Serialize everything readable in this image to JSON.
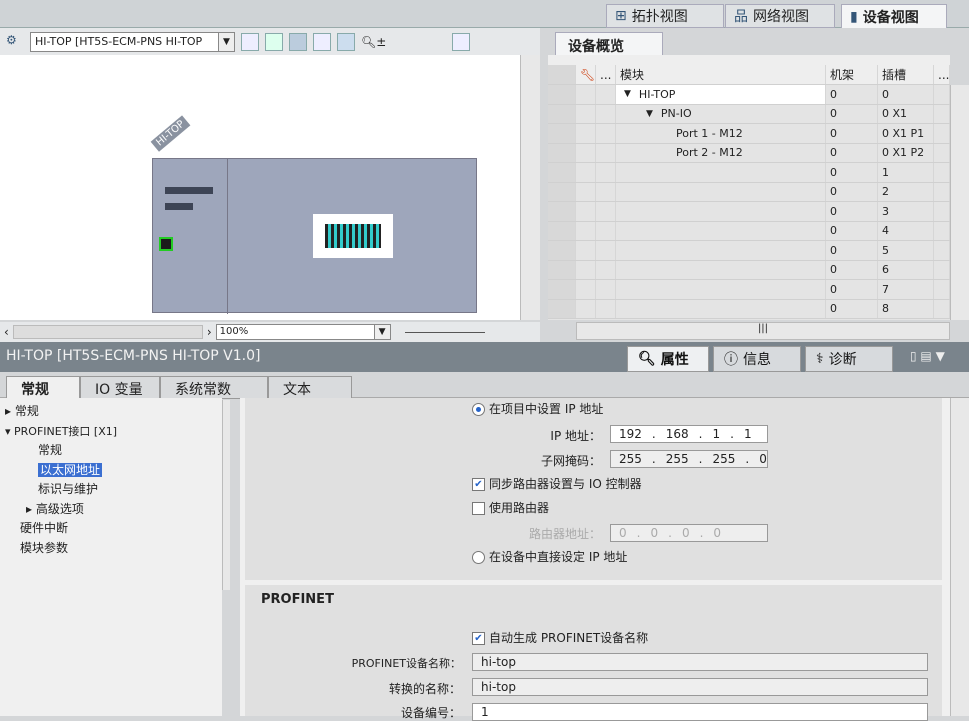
{
  "view_tabs": [
    {
      "label": "拓扑视图",
      "icon": "topology-icon"
    },
    {
      "label": "网络视图",
      "icon": "network-icon"
    },
    {
      "label": "设备视图",
      "icon": "device-icon",
      "active": true
    }
  ],
  "toolbar": {
    "device_select": "HI-TOP [HT5S-ECM-PNS HI-TOP"
  },
  "canvas": {
    "device_label": "HI-TOP",
    "zoom": "100%"
  },
  "overview": {
    "tab": "设备概览",
    "headers": [
      "...",
      "模块",
      "机架",
      "插槽",
      "..."
    ],
    "rows": [
      {
        "module": "HI-TOP",
        "rack": "0",
        "slot": "0",
        "level": 0,
        "expand": "▼"
      },
      {
        "module": "PN-IO",
        "rack": "0",
        "slot": "0 X1",
        "level": 1,
        "expand": "▼"
      },
      {
        "module": "Port 1 - M12",
        "rack": "0",
        "slot": "0 X1 P1",
        "level": 2,
        "expand": ""
      },
      {
        "module": "Port 2 - M12",
        "rack": "0",
        "slot": "0 X1 P2",
        "level": 2,
        "expand": ""
      },
      {
        "module": "",
        "rack": "0",
        "slot": "1"
      },
      {
        "module": "",
        "rack": "0",
        "slot": "2"
      },
      {
        "module": "",
        "rack": "0",
        "slot": "3"
      },
      {
        "module": "",
        "rack": "0",
        "slot": "4"
      },
      {
        "module": "",
        "rack": "0",
        "slot": "5"
      },
      {
        "module": "",
        "rack": "0",
        "slot": "6"
      },
      {
        "module": "",
        "rack": "0",
        "slot": "7"
      },
      {
        "module": "",
        "rack": "0",
        "slot": "8"
      }
    ],
    "hscroll": "|||"
  },
  "inspector": {
    "title": "HI-TOP [HT5S-ECM-PNS HI-TOP V1.0]",
    "tabs": [
      "属性",
      "信息",
      "诊断"
    ],
    "subtabs": [
      "常规",
      "IO 变量",
      "系统常数",
      "文本"
    ],
    "tree": [
      "常规",
      "PROFINET接口 [X1]",
      "常规",
      "以太网地址",
      "标识与维护",
      "高级选项",
      "硬件中断",
      "模块参数"
    ],
    "ip": {
      "set_in_project": "在项目中设置 IP 地址",
      "ip_label": "IP 地址：",
      "ip": [
        "192",
        "168",
        "1",
        "1"
      ],
      "mask_label": "子网掩码：",
      "mask": [
        "255",
        "255",
        "255",
        "0"
      ],
      "sync_router": "同步路由器设置与 IO 控制器",
      "use_router": "使用路由器",
      "router_label": "路由器地址：",
      "router": [
        "0",
        "0",
        "0",
        "0"
      ],
      "set_on_device": "在设备中直接设定 IP 地址"
    },
    "profinet": {
      "heading": "PROFINET",
      "auto_name": "自动生成 PROFINET设备名称",
      "name_label": "PROFINET设备名称：",
      "name": "hi-top",
      "converted_label": "转换的名称：",
      "converted": "hi-top",
      "number_label": "设备编号：",
      "number": "1"
    }
  }
}
